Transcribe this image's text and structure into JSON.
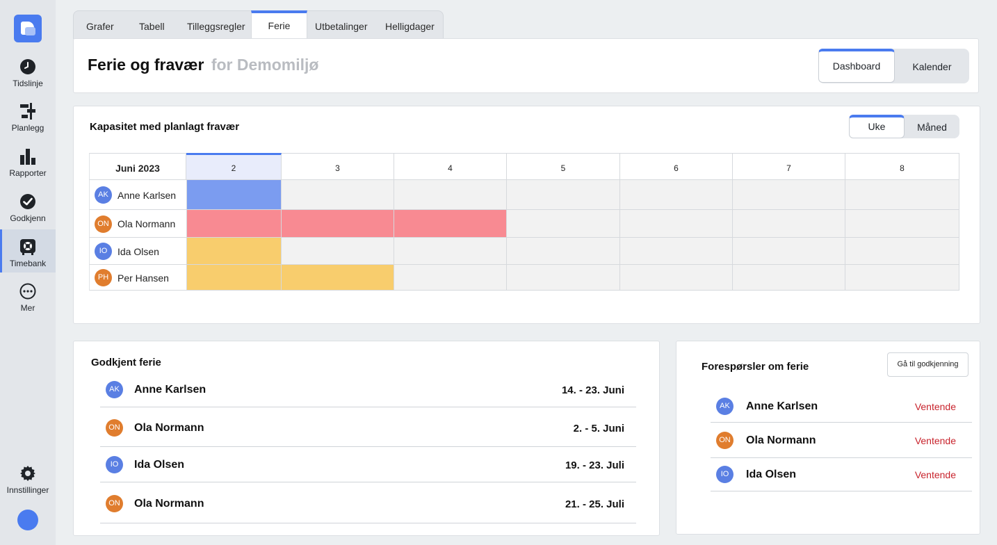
{
  "sidebar": {
    "items": [
      {
        "label": "Tidslinje",
        "icon": "clock-icon"
      },
      {
        "label": "Planlegg",
        "icon": "plan-icon"
      },
      {
        "label": "Rapporter",
        "icon": "bar-chart-icon"
      },
      {
        "label": "Godkjenn",
        "icon": "check-circle-icon"
      },
      {
        "label": "Timebank",
        "icon": "timebank-icon"
      },
      {
        "label": "Mer",
        "icon": "more-icon"
      }
    ],
    "settings_label": "Innstillinger"
  },
  "tabs": [
    "Grafer",
    "Tabell",
    "Tilleggsregler",
    "Ferie",
    "Utbetalinger",
    "Helligdager"
  ],
  "active_tab": "Ferie",
  "header": {
    "title": "Ferie og fravær",
    "subtitle": "for Demomiljø",
    "view_toggle": [
      "Dashboard",
      "Kalender"
    ]
  },
  "capacity": {
    "title": "Kapasitet med planlagt fravær",
    "period_toggle": [
      "Uke",
      "Måned"
    ],
    "month_label": "Juni 2023",
    "days": [
      "2",
      "3",
      "4",
      "5",
      "6",
      "7",
      "8"
    ],
    "rows": [
      {
        "initials": "AK",
        "name": "Anne Karlsen",
        "color": "blue"
      },
      {
        "initials": "ON",
        "name": "Ola Normann",
        "color": "orange"
      },
      {
        "initials": "IO",
        "name": "Ida Olsen",
        "color": "blue"
      },
      {
        "initials": "PH",
        "name": "Per Hansen",
        "color": "orange"
      }
    ]
  },
  "colors": {
    "accent": "#4a7bef",
    "vacation_blue": "#7b9cf0",
    "vacation_red": "#f88a92",
    "vacation_yellow": "#f8cd6d",
    "empty_cell": "#f2f2f2",
    "pending": "#c8232c"
  },
  "approved": {
    "title": "Godkjent ferie",
    "items": [
      {
        "initials": "AK",
        "name": "Anne Karlsen",
        "dates": "14. - 23. Juni",
        "color": "blue"
      },
      {
        "initials": "ON",
        "name": "Ola Normann",
        "dates": "2. - 5. Juni",
        "color": "orange"
      },
      {
        "initials": "IO",
        "name": "Ida Olsen",
        "dates": "19. - 23. Juli",
        "color": "blue"
      },
      {
        "initials": "ON",
        "name": "Ola Normann",
        "dates": "21. - 25. Juli",
        "color": "orange"
      }
    ]
  },
  "requests": {
    "title": "Forespørsler om ferie",
    "button_label": "Gå til godkjenning",
    "items": [
      {
        "initials": "AK",
        "name": "Anne Karlsen",
        "status": "Ventende",
        "color": "blue"
      },
      {
        "initials": "ON",
        "name": "Ola Normann",
        "status": "Ventende",
        "color": "orange"
      },
      {
        "initials": "IO",
        "name": "Ida Olsen",
        "status": "Ventende",
        "color": "blue"
      }
    ]
  }
}
